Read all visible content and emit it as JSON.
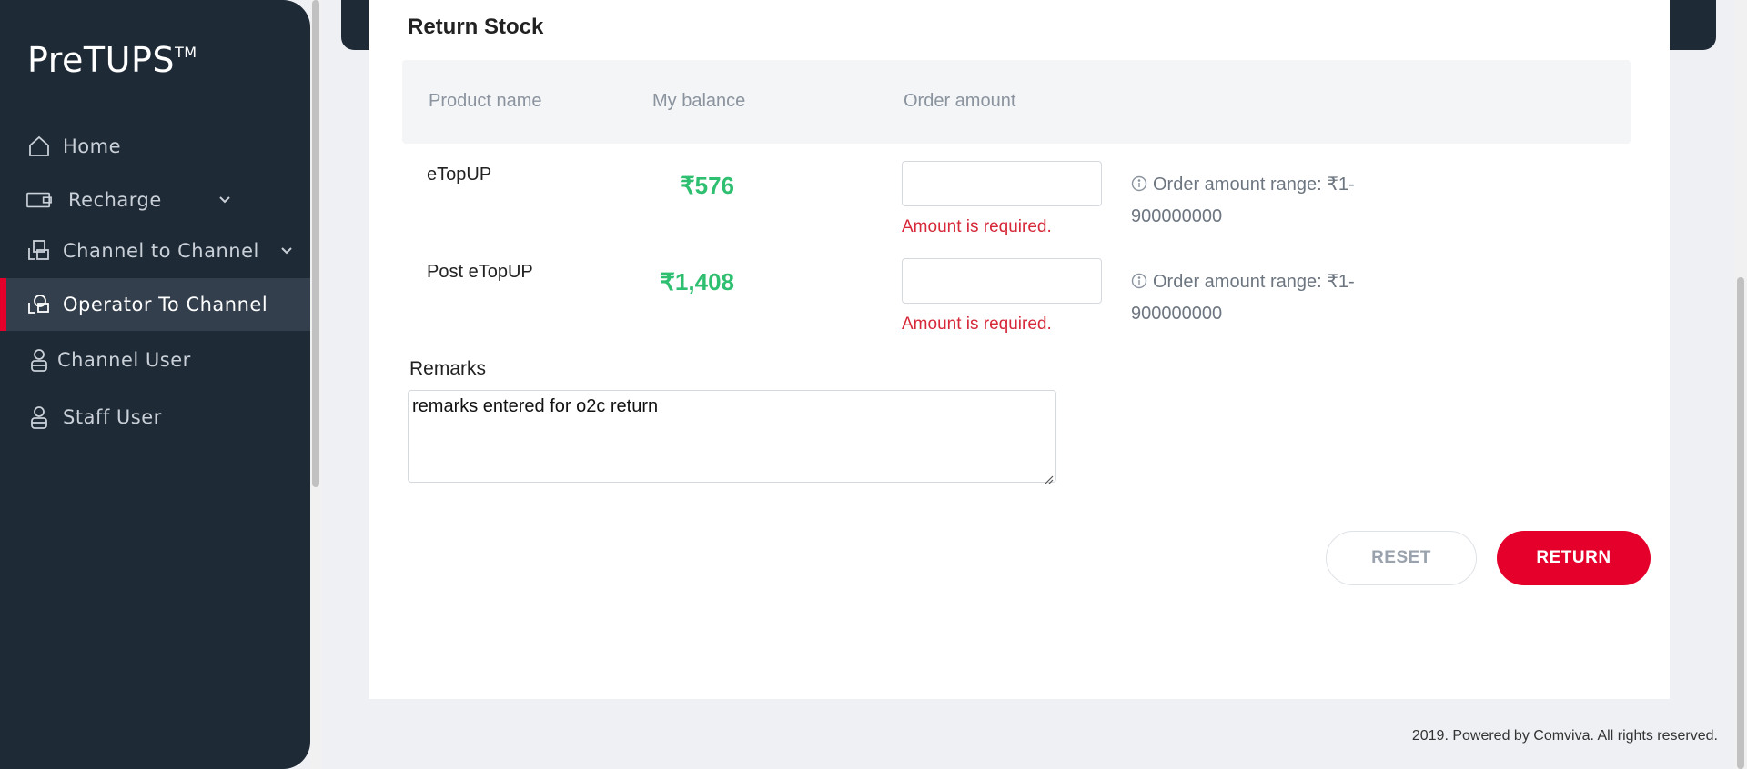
{
  "sidebar": {
    "brand": "PreTUPS",
    "brand_tm": "TM",
    "items": [
      {
        "label": "Home",
        "icon": "home-icon"
      },
      {
        "label": "Recharge",
        "icon": "wallet-icon",
        "expandable": true
      },
      {
        "label": "Channel to Channel",
        "icon": "transfer-icon",
        "expandable": true
      },
      {
        "label": "Operator To Channel",
        "icon": "operator-icon",
        "active": true
      },
      {
        "label": "Channel User",
        "icon": "user-icon"
      },
      {
        "label": "Staff User",
        "icon": "user-icon"
      }
    ]
  },
  "form": {
    "title": "Return Stock",
    "columns": {
      "product": "Product name",
      "balance": "My balance",
      "amount": "Order amount"
    },
    "rows": [
      {
        "product": "eTopUP",
        "balance": "₹576",
        "amount_value": "",
        "error": "Amount is required.",
        "range_line1": "Order amount range: ₹1-",
        "range_line2": "900000000"
      },
      {
        "product": "Post eTopUP",
        "balance": "₹1,408",
        "amount_value": "",
        "error": "Amount is required.",
        "range_line1": "Order amount range: ₹1-",
        "range_line2": "900000000"
      }
    ],
    "remarks_label": "Remarks",
    "remarks_value": "remarks entered for o2c return",
    "reset_label": "RESET",
    "return_label": "RETURN"
  },
  "footer": "2019. Powered by Comviva. All rights reserved.",
  "colors": {
    "sidebar_bg": "#1f2a37",
    "accent": "#e4002b",
    "balance": "#2fbf71",
    "error": "#d62839"
  }
}
